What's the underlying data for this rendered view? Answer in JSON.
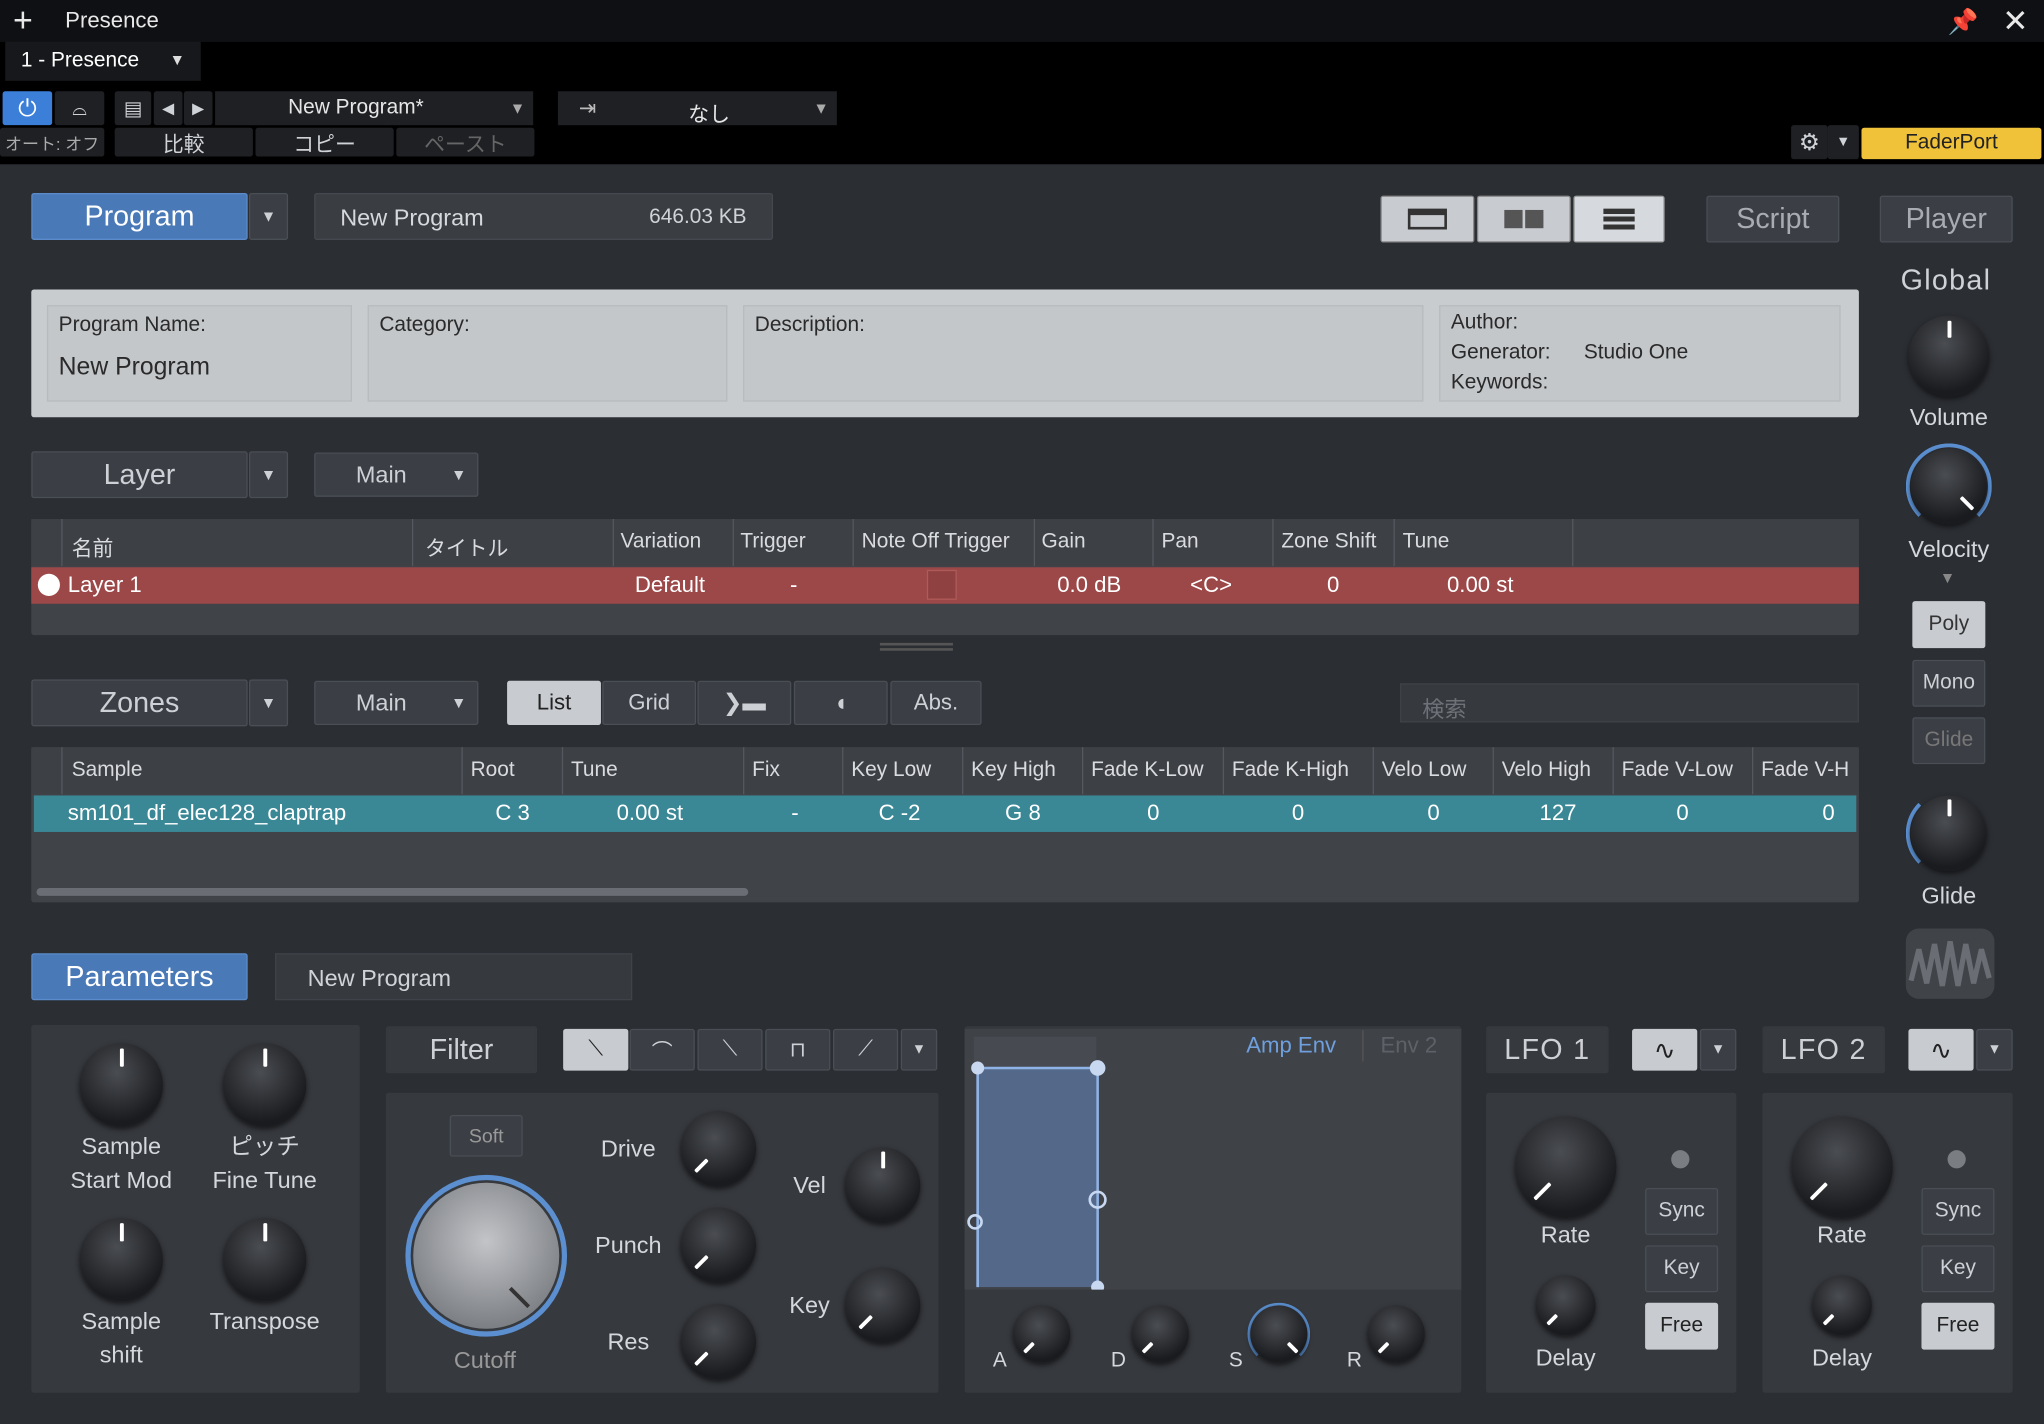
{
  "window": {
    "title": "Presence",
    "instance": "1 - Presence"
  },
  "host": {
    "preset": "New Program*",
    "sidechain": "なし",
    "auto": "オート: オフ",
    "compare": "比較",
    "copy": "コピー",
    "paste": "ペースト",
    "device": "FaderPort"
  },
  "topbar": {
    "program_tab": "Program",
    "program_name": "New Program",
    "program_size": "646.03 KB",
    "script": "Script",
    "player": "Player"
  },
  "info": {
    "program_name_label": "Program Name:",
    "program_name_value": "New Program",
    "category_label": "Category:",
    "description_label": "Description:",
    "author_label": "Author:",
    "generator_label": "Generator:",
    "generator_value": "Studio One",
    "keywords_label": "Keywords:"
  },
  "layer": {
    "tab": "Layer",
    "group": "Main",
    "columns": [
      "名前",
      "タイトル",
      "Variation",
      "Trigger",
      "Note Off Trigger",
      "Gain",
      "Pan",
      "Zone Shift",
      "Tune"
    ],
    "row": {
      "name": "Layer 1",
      "title": "",
      "variation": "Default",
      "trigger": "-",
      "gain": "0.0 dB",
      "pan": "<C>",
      "zone_shift": "0",
      "tune": "0.00 st"
    }
  },
  "zones": {
    "tab": "Zones",
    "group": "Main",
    "view_list": "List",
    "view_grid": "Grid",
    "abs": "Abs.",
    "search_placeholder": "検索",
    "columns": [
      "Sample",
      "Root",
      "Tune",
      "Fix",
      "Key Low",
      "Key High",
      "Fade K-Low",
      "Fade K-High",
      "Velo Low",
      "Velo High",
      "Fade V-Low",
      "Fade V-H"
    ],
    "row": [
      "sm101_df_elec128_claptrap",
      "C 3",
      "0.00 st",
      "-",
      "C -2",
      "G 8",
      "0",
      "0",
      "0",
      "127",
      "0",
      "0"
    ]
  },
  "global": {
    "title": "Global",
    "volume": "Volume",
    "velocity": "Velocity",
    "poly": "Poly",
    "mono": "Mono",
    "glide_btn": "Glide",
    "glide": "Glide"
  },
  "params": {
    "tab": "Parameters",
    "name": "New Program",
    "sample_start_1": "Sample",
    "sample_start_2": "Start Mod",
    "pitch_1": "ピッチ",
    "pitch_2": "Fine Tune",
    "sample_shift_1": "Sample",
    "sample_shift_2": "shift",
    "transpose": "Transpose"
  },
  "filter": {
    "title": "Filter",
    "soft": "Soft",
    "drive": "Drive",
    "punch": "Punch",
    "res": "Res",
    "vel": "Vel",
    "key": "Key",
    "cutoff": "Cutoff"
  },
  "env": {
    "amp": "Amp Env",
    "env2": "Env 2",
    "a": "A",
    "d": "D",
    "s": "S",
    "r": "R"
  },
  "lfo1": {
    "title": "LFO 1",
    "rate": "Rate",
    "delay": "Delay",
    "sync": "Sync",
    "key": "Key",
    "free": "Free"
  },
  "lfo2": {
    "title": "LFO 2",
    "rate": "Rate",
    "delay": "Delay",
    "sync": "Sync",
    "key": "Key",
    "free": "Free"
  }
}
